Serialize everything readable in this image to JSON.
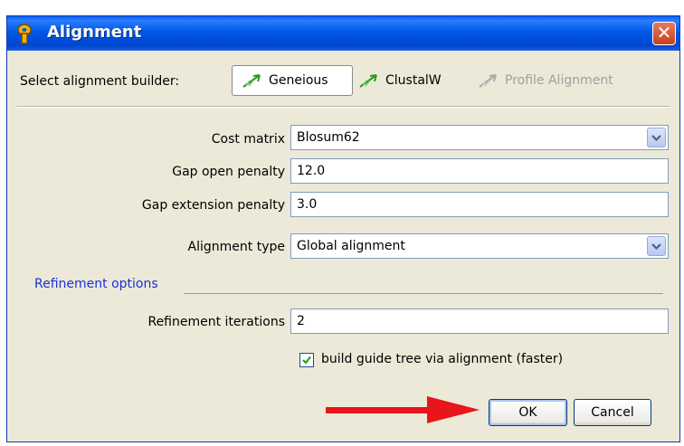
{
  "window": {
    "title": "Alignment",
    "close_label": "✕"
  },
  "builder": {
    "label": "Select alignment builder:",
    "options": [
      {
        "label": "Geneious",
        "state": "selected"
      },
      {
        "label": "ClustalW",
        "state": "enabled"
      },
      {
        "label": "Profile Alignment",
        "state": "disabled"
      }
    ]
  },
  "form": {
    "cost_matrix": {
      "label": "Cost matrix",
      "value": "Blosum62"
    },
    "gap_open": {
      "label": "Gap open penalty",
      "value": "12.0"
    },
    "gap_extension": {
      "label": "Gap extension penalty",
      "value": "3.0"
    },
    "alignment_type": {
      "label": "Alignment type",
      "value": "Global alignment"
    }
  },
  "refinement": {
    "section_title": "Refinement options",
    "iterations": {
      "label": "Refinement iterations",
      "value": "2"
    },
    "guide_tree": {
      "label": "build guide tree via alignment (faster)",
      "checked": true
    }
  },
  "buttons": {
    "ok": "OK",
    "cancel": "Cancel"
  },
  "colors": {
    "title_bar": "#0058e6",
    "dialog_bg": "#ece9d8",
    "section_title": "#1c2fd8",
    "arrow": "#e8151b"
  }
}
